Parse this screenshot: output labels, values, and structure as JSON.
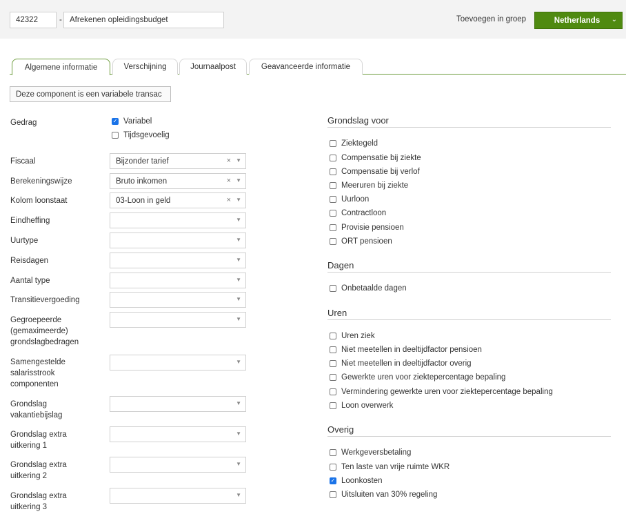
{
  "header": {
    "code": "42322",
    "separator": "-",
    "name": "Afrekenen opleidingsbudget",
    "group_label": "Toevoegen in groep",
    "group_button": "Netherlands"
  },
  "tabs": [
    {
      "label": "Algemene informatie",
      "active": true
    },
    {
      "label": "Verschijning",
      "active": false
    },
    {
      "label": "Journaalpost",
      "active": false
    },
    {
      "label": "Geavanceerde informatie",
      "active": false
    }
  ],
  "variable_button": "Deze component is een variabele transac",
  "gedrag": {
    "label": "Gedrag",
    "options": [
      {
        "label": "Variabel",
        "checked": true
      },
      {
        "label": "Tijdsgevoelig",
        "checked": false
      }
    ]
  },
  "fields": [
    {
      "label": "Fiscaal",
      "value": "Bijzonder tarief",
      "clearable": true
    },
    {
      "label": "Berekeningswijze",
      "value": "Bruto inkomen",
      "clearable": true
    },
    {
      "label": "Kolom loonstaat",
      "value": "03-Loon in geld",
      "clearable": true
    },
    {
      "label": "Eindheffing",
      "value": "",
      "clearable": false
    },
    {
      "label": "Uurtype",
      "value": "",
      "clearable": false
    },
    {
      "label": "Reisdagen",
      "value": "",
      "clearable": false
    },
    {
      "label": "Aantal type",
      "value": "",
      "clearable": false
    },
    {
      "label": "Transitievergoeding",
      "value": "",
      "clearable": false
    },
    {
      "label": "Gegroepeerde (gemaximeerde) grondslagbedragen",
      "value": "",
      "clearable": false
    },
    {
      "label": "Samengestelde salarisstrook componenten",
      "value": "",
      "clearable": false
    },
    {
      "label": "Grondslag vakantiebijslag",
      "value": "",
      "clearable": false
    },
    {
      "label": "Grondslag extra uitkering 1",
      "value": "",
      "clearable": false
    },
    {
      "label": "Grondslag extra uitkering 2",
      "value": "",
      "clearable": false
    },
    {
      "label": "Grondslag extra uitkering 3",
      "value": "",
      "clearable": false
    }
  ],
  "sections": [
    {
      "title": "Grondslag voor",
      "items": [
        {
          "label": "Ziektegeld",
          "checked": false
        },
        {
          "label": "Compensatie bij ziekte",
          "checked": false
        },
        {
          "label": "Compensatie bij verlof",
          "checked": false
        },
        {
          "label": "Meeruren bij ziekte",
          "checked": false
        },
        {
          "label": "Uurloon",
          "checked": false
        },
        {
          "label": "Contractloon",
          "checked": false
        },
        {
          "label": "Provisie pensioen",
          "checked": false
        },
        {
          "label": "ORT pensioen",
          "checked": false
        }
      ]
    },
    {
      "title": "Dagen",
      "items": [
        {
          "label": "Onbetaalde dagen",
          "checked": false
        }
      ]
    },
    {
      "title": "Uren",
      "items": [
        {
          "label": "Uren ziek",
          "checked": false
        },
        {
          "label": "Niet meetellen in deeltijdfactor pensioen",
          "checked": false
        },
        {
          "label": "Niet meetellen in deeltijdfactor overig",
          "checked": false
        },
        {
          "label": "Gewerkte uren voor ziektepercentage bepaling",
          "checked": false
        },
        {
          "label": "Vermindering gewerkte uren voor ziektepercentage bepaling",
          "checked": false
        },
        {
          "label": "Loon overwerk",
          "checked": false
        }
      ]
    },
    {
      "title": "Overig",
      "items": [
        {
          "label": "Werkgeversbetaling",
          "checked": false
        },
        {
          "label": "Ten laste van vrije ruimte WKR",
          "checked": false
        },
        {
          "label": "Loonkosten",
          "checked": true
        },
        {
          "label": "Uitsluiten van 30% regeling",
          "checked": false
        }
      ]
    }
  ]
}
